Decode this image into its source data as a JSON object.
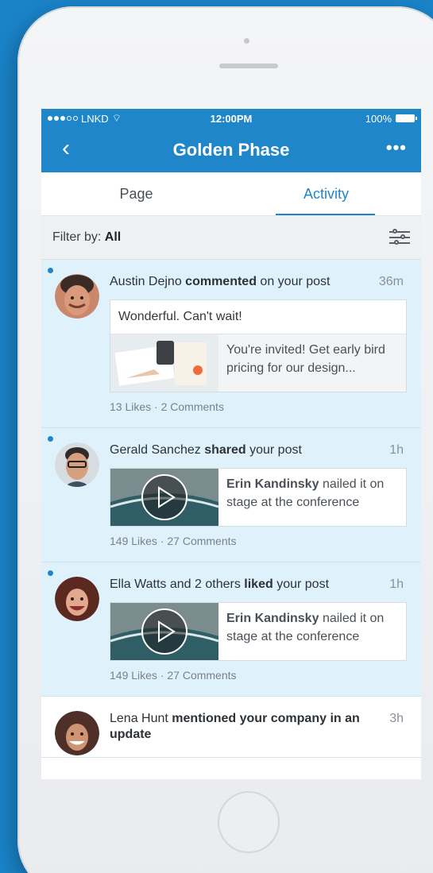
{
  "status": {
    "carrier": "LNKD",
    "time": "12:00PM",
    "battery": "100%"
  },
  "nav": {
    "back": "‹",
    "title": "Golden Phase",
    "more": "•••"
  },
  "tabs": [
    "Page",
    "Activity"
  ],
  "filter": {
    "label": "Filter by:",
    "value": "All"
  },
  "feed": [
    {
      "actor": "Austin Dejno",
      "action": "commented",
      "rest": "on your post",
      "time": "36m",
      "comment": "Wonderful. Can't wait!",
      "share_text": "You're invited! Get early bird pricing for our design...",
      "stats": "13 Likes · 2 Comments"
    },
    {
      "actor": "Gerald Sanchez",
      "action": "shared",
      "rest": "your post",
      "time": "1h",
      "share_bold": "Erin Kandinsky",
      "share_rest": "nailed it on stage at the conference",
      "stats": "149 Likes · 27 Comments"
    },
    {
      "actor": "Ella Watts and 2 others",
      "action": "liked",
      "rest": "your post",
      "time": "1h",
      "share_bold": "Erin Kandinsky",
      "share_rest": "nailed it on stage at the conference",
      "stats": "149 Likes · 27 Comments"
    },
    {
      "actor": "Lena Hunt",
      "action": "mentioned your company in an update",
      "time": "3h"
    }
  ]
}
